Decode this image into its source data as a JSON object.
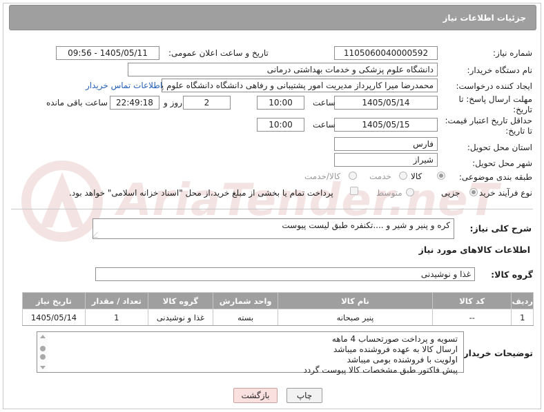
{
  "header": {
    "title": "جزئیات اطلاعات نیاز"
  },
  "fields": {
    "need_number_label": "شماره نیاز:",
    "need_number": "1105060040000592",
    "announce_label": "تاریخ و ساعت اعلان عمومی:",
    "announce_value": "1405/05/11 - 09:56",
    "buyer_org_label": "نام دستگاه خریدار:",
    "buyer_org": "دانشگاه علوم پزشکی و خدمات بهداشتی درمانی",
    "requester_label": "ایجاد کننده درخواست:",
    "requester": "محمدرضا میرا کارپرداز مدیریت امور پشتیبانی و رفاهی دانشگاه دانشگاه علوم پزشکی",
    "contact_link": "اطلاعات تماس خریدار",
    "deadline_label_1": "مهلت ارسال پاسخ: تا",
    "deadline_label_2": "تاریخ:",
    "deadline_date": "1405/05/14",
    "time_label": "ساعت",
    "deadline_time": "10:00",
    "days_value": "2",
    "days_label": "روز و",
    "remaining_time": "22:49:18",
    "remaining_label": "ساعت باقی مانده",
    "min_price_label_1": "حداقل تاریخ اعتبار قیمت:",
    "min_price_label_2": "تا تاریخ:",
    "min_price_date": "1405/05/15",
    "min_price_time": "10:00",
    "province_label": "استان محل تحویل:",
    "province": "فارس",
    "city_label": "شهر محل تحویل:",
    "city": "شیراز",
    "category_label": "طبقه بندی موضوعی:",
    "category_options": [
      "کالا",
      "خدمت",
      "کالا/خدمت"
    ],
    "purchase_type_label": "نوع فرآیند خرید :",
    "purchase_options": [
      "جزیی",
      "متوسط"
    ],
    "payment_note": "پرداخت تمام یا بخشی از مبلغ خرید،از محل \"اسناد خزانه اسلامی\" خواهد بود."
  },
  "summary": {
    "label": "شرح کلی نیاز:",
    "value": "کره و پنیر و شیر و ....تکنفره  طبق لیست پیوست"
  },
  "goods_section": {
    "title": "اطلاعات کالاهای مورد نیاز",
    "group_label": "گروه کالا:",
    "group_value": "غذا و نوشیدنی"
  },
  "table": {
    "headers": [
      "ردیف",
      "کد کالا",
      "نام کالا",
      "واحد شمارش",
      "گروه کالا",
      "تعداد / مقدار",
      "تاریخ نیاز"
    ],
    "rows": [
      [
        "1",
        "--",
        "پنیر صبحانه",
        "بسته",
        "غذا و نوشیدنی",
        "1",
        "1405/05/14"
      ]
    ]
  },
  "notes": {
    "label": "توضیحات خریدار:",
    "lines": [
      "تسویه و پرداخت صورتحساب 4 ماهه",
      "ارسال کالا به عهده فروشنده میباشد",
      "اولویت با فروشنده بومی میباشد",
      "پیش فاکتور طبق مشخصات کالا پیوست گردد"
    ]
  },
  "buttons": {
    "print": "چاپ",
    "back": "بازگشت"
  },
  "watermark": {
    "text": "AriaTender.neT"
  },
  "colors": {
    "header_bg": "#9f9f9f",
    "link": "#2660b5",
    "back_button": "#fbe0e0"
  }
}
